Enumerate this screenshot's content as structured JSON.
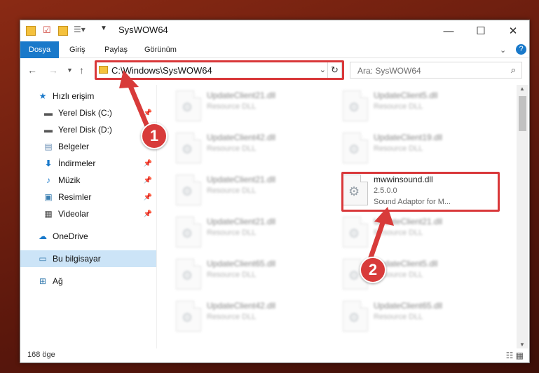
{
  "window": {
    "title": "SysWOW64",
    "status": "168 öge"
  },
  "ribbon": {
    "tabs": [
      "Dosya",
      "Giriş",
      "Paylaş",
      "Görünüm"
    ]
  },
  "address": {
    "path": "C:\\Windows\\SysWOW64",
    "search_placeholder": "Ara: SysWOW64"
  },
  "sidebar": {
    "items": [
      {
        "label": "Hızlı erişim",
        "icon": "star-icon"
      },
      {
        "label": "Yerel Disk (C:)",
        "icon": "drive-icon"
      },
      {
        "label": "Yerel Disk (D:)",
        "icon": "drive-icon"
      },
      {
        "label": "Belgeler",
        "icon": "documents-icon"
      },
      {
        "label": "İndirmeler",
        "icon": "download-icon"
      },
      {
        "label": "Müzik",
        "icon": "music-icon"
      },
      {
        "label": "Resimler",
        "icon": "pictures-icon"
      },
      {
        "label": "Videolar",
        "icon": "video-icon"
      },
      {
        "label": "OneDrive",
        "icon": "cloud-icon"
      },
      {
        "label": "Bu bilgisayar",
        "icon": "computer-icon"
      },
      {
        "label": "Ağ",
        "icon": "network-icon"
      }
    ]
  },
  "files": [
    {
      "name": "UpdateClient21.dll",
      "desc": "Resource DLL"
    },
    {
      "name": "UpdateClient5.dll",
      "desc": "Resource DLL"
    },
    {
      "name": "UpdateClient42.dll",
      "desc": "Resource DLL"
    },
    {
      "name": "UpdateClient19.dll",
      "desc": "Resource DLL"
    },
    {
      "name": "UpdateClient21.dll",
      "desc": "Resource DLL"
    },
    {
      "name": "mwwinsound.dll",
      "desc": "2.5.0.0",
      "desc2": "Sound Adaptor for M..."
    },
    {
      "name": "UpdateClient21.dll",
      "desc": "Resource DLL"
    },
    {
      "name": "UpdateClient21.dll",
      "desc": "Resource DLL"
    },
    {
      "name": "UpdateClient65.dll",
      "desc": "Resource DLL"
    },
    {
      "name": "UpdateClient5.dll",
      "desc": "Resource DLL"
    },
    {
      "name": "UpdateClient42.dll",
      "desc": "Resource DLL"
    },
    {
      "name": "UpdateClient65.dll",
      "desc": "Resource DLL"
    }
  ],
  "annotations": {
    "badge1": "1",
    "badge2": "2"
  },
  "colors": {
    "accent": "#1979ca",
    "highlight": "#d9383a"
  }
}
